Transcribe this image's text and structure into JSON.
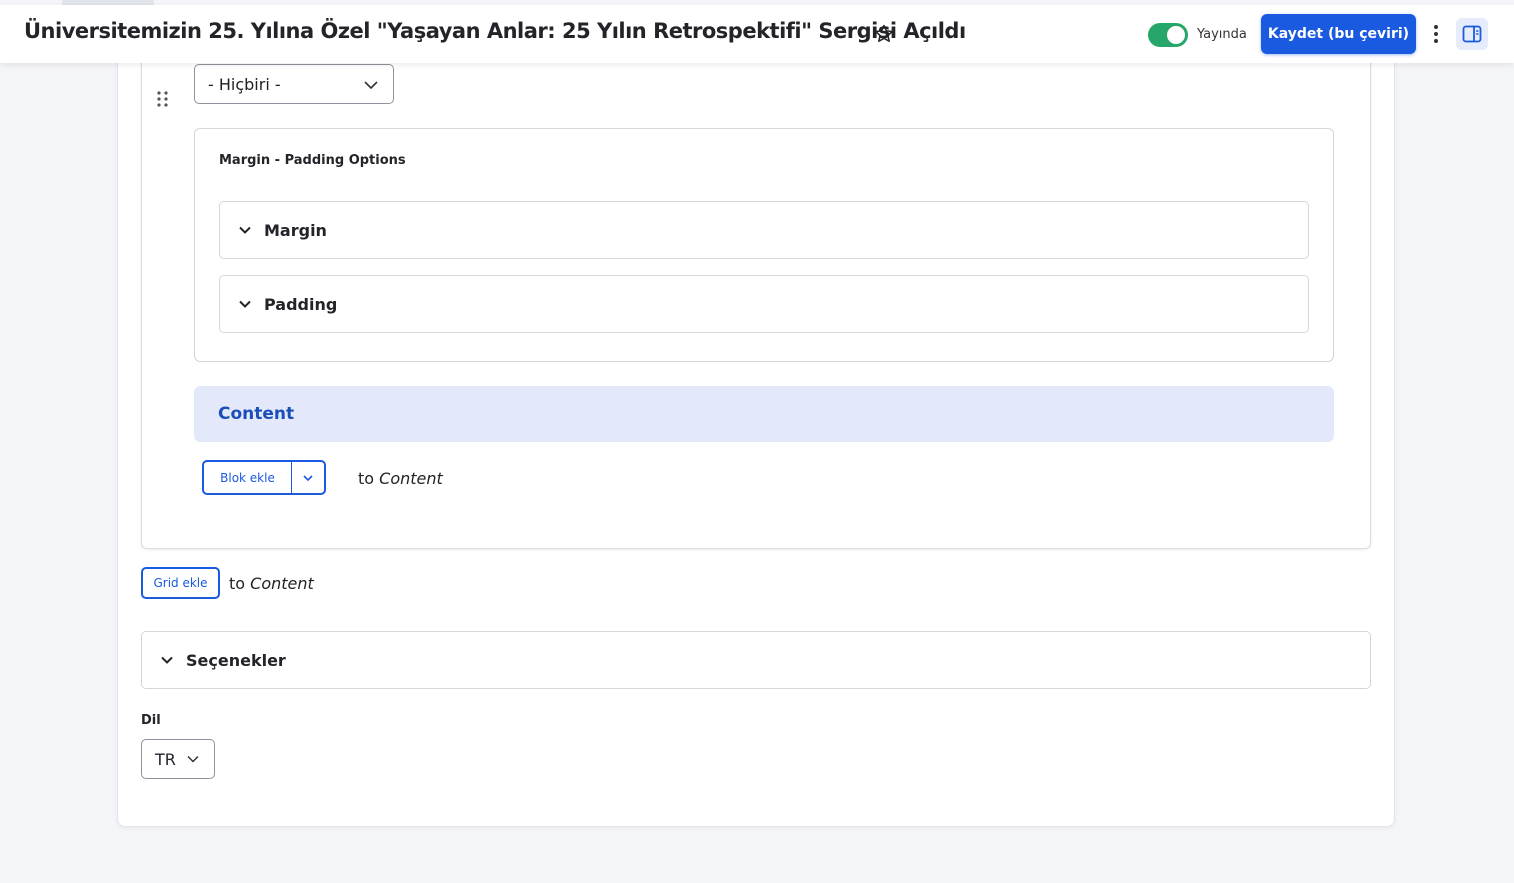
{
  "header": {
    "title": "Üniversitemizin 25. Yılına Özel \"Yaşayan Anlar: 25 Yılın Retrospektifi\" Sergisi Açıldı",
    "publish_label": "Yayında",
    "publish_on": true,
    "save_label": "Kaydet (bu çeviri)"
  },
  "colors": {
    "primary": "#1a5ae0",
    "toggle_on": "#26a769",
    "region_bg": "#e3e9fb"
  },
  "form": {
    "select_value": "- Hiçbiri -",
    "margin_padding_title": "Margin - Padding Options",
    "margin_label": "Margin",
    "padding_label": "Padding",
    "content_region_label": "Content",
    "add_block_label": "Blok ekle",
    "add_block_to_prefix": "to",
    "add_block_to_target": "Content",
    "add_grid_label": "Grid ekle",
    "add_grid_to_prefix": "to",
    "add_grid_to_target": "Content",
    "options_label": "Seçenekler",
    "language_label": "Dil",
    "language_value": "TR"
  }
}
